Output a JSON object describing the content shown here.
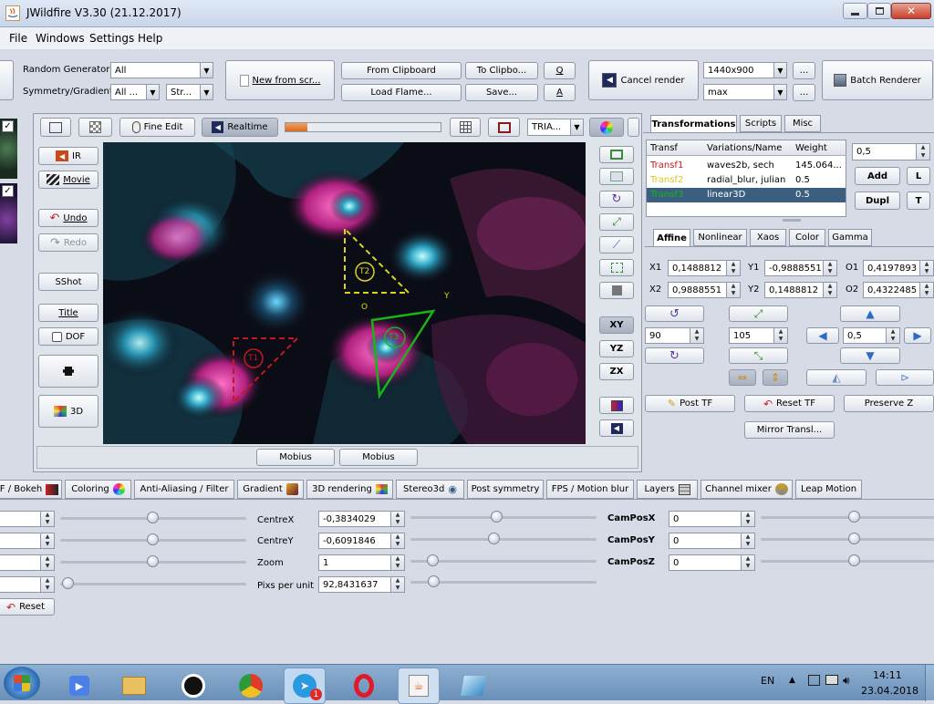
{
  "window": {
    "title": "JWildfire V3.30 (21.12.2017)"
  },
  "menu": [
    "File",
    "Windows",
    "Settings",
    "Help"
  ],
  "toolbar": {
    "random_generator_label": "Random Generator",
    "random_generator_value": "All",
    "symmetry_label": "Symmetry/Gradient",
    "symmetry_value": "All ...",
    "gradient_value": "Str...",
    "new_from_scratch": "New from scr...",
    "from_clipboard": "From Clipboard",
    "to_clipboard": "To Clipbo...",
    "q": "Q",
    "load_flame": "Load Flame...",
    "save": "Save...",
    "a": "A",
    "cancel_render": "Cancel render",
    "resolution": "1440x900",
    "quality": "max",
    "ellipsis": "...",
    "batch_renderer": "Batch Renderer"
  },
  "preview_toolbar": {
    "fine_edit": "Fine Edit",
    "realtime": "Realtime",
    "shape_combo": "TRIA...",
    "progress": 0.14
  },
  "left_tools": {
    "ir": "IR",
    "movie": "Movie",
    "undo": "Undo",
    "redo": "Redo",
    "sshot": "SShot",
    "title": "Title",
    "dof": "DOF",
    "three_d": "3D"
  },
  "canvas": {
    "t1": "T1",
    "t2": "T2",
    "t3": "T3",
    "o": "O",
    "y": "Y",
    "colors": {
      "t1": "#c8161e",
      "t2": "#d8d41c",
      "t3": "#18b418"
    }
  },
  "right_axis": {
    "xy": "XY",
    "yz": "YZ",
    "zx": "ZX"
  },
  "bottom_canvas": {
    "mobius1": "Mobius",
    "mobius2": "Mobius"
  },
  "right_panel": {
    "tabs": [
      "Transformations",
      "Scripts",
      "Misc"
    ],
    "table_headers": [
      "Transf",
      "Variations/Name",
      "Weight"
    ],
    "rows": [
      {
        "transf": "Transf1",
        "variations": "waves2b, sech",
        "weight": "145.064...",
        "color": "#c8161e"
      },
      {
        "transf": "Transf2",
        "variations": "radial_blur, julian",
        "weight": "0.5",
        "color": "#d8c81c"
      },
      {
        "transf": "Transf3",
        "variations": "linear3D",
        "weight": "0.5",
        "color": "#18b418"
      }
    ],
    "weight_field": "0,5",
    "add": "Add",
    "l": "L",
    "dupl": "Dupl",
    "t": "T",
    "subtabs": [
      "Affine",
      "Nonlinear",
      "Xaos",
      "Color",
      "Gamma"
    ],
    "affine": {
      "x1_label": "X1",
      "x1": "0,1488812",
      "y1_label": "Y1",
      "y1": "-0,9888551",
      "o1_label": "O1",
      "o1": "0,4197893",
      "x2_label": "X2",
      "x2": "0,9888551",
      "y2_label": "Y2",
      "y2": "0,1488812",
      "o2_label": "O2",
      "o2": "0,4322485"
    },
    "rotate_value": "90",
    "scale_value": "105",
    "move_value": "0,5",
    "post_tf": "Post TF",
    "reset_tf": "Reset TF",
    "preserve_z": "Preserve Z",
    "mirror_transl": "Mirror Transl..."
  },
  "bottom_tabs": [
    {
      "label": "F / Bokeh",
      "icon": "bokeh-icon"
    },
    {
      "label": "Coloring",
      "icon": "color-wheel-icon"
    },
    {
      "label": "Anti-Aliasing / Filter",
      "icon": ""
    },
    {
      "label": "Gradient",
      "icon": "gradient-icon"
    },
    {
      "label": "3D rendering",
      "icon": "3d-render-icon"
    },
    {
      "label": "Stereo3d",
      "icon": "eye-icon"
    },
    {
      "label": "Post symmetry",
      "icon": ""
    },
    {
      "label": "FPS / Motion blur",
      "icon": ""
    },
    {
      "label": "Layers",
      "icon": "layers-icon"
    },
    {
      "label": "Channel mixer",
      "icon": "mixer-icon"
    },
    {
      "label": "Leap Motion",
      "icon": ""
    }
  ],
  "camera": {
    "centrex_label": "CentreX",
    "centrex": "-0,3834029",
    "centrey_label": "CentreY",
    "centrey": "-0,6091846",
    "zoom_label": "Zoom",
    "zoom": "1",
    "pixs_label": "Pixs per unit",
    "pixs": "92,8431637",
    "camposx_label": "CamPosX",
    "camposx": "0",
    "camposy_label": "CamPosY",
    "camposy": "0",
    "camposz_label": "CamPosZ",
    "camposz": "0",
    "reset": "Reset"
  },
  "taskbar": {
    "lang": "EN",
    "time": "14:11",
    "date": "23.04.2018",
    "telegram_badge": "1"
  }
}
